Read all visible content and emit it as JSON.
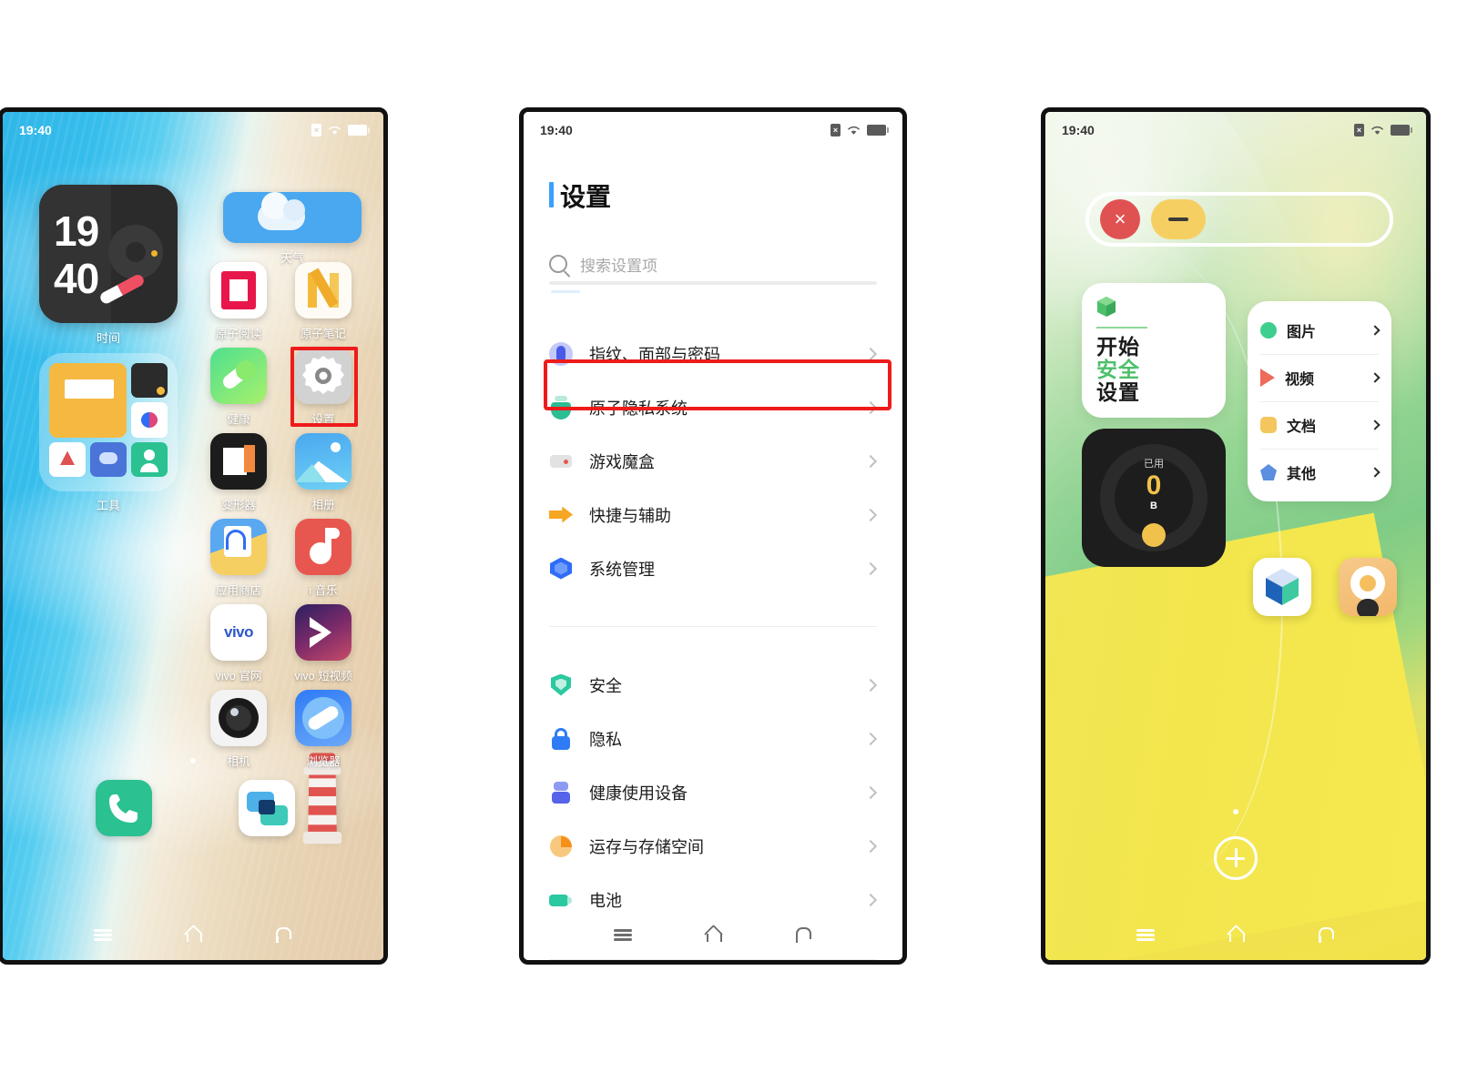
{
  "colors": {
    "highlight": "#ee1b1b",
    "accent_blue": "#3aa0ff",
    "accent_green": "#4cbf6a",
    "usage_yellow": "#f0c14b",
    "close_red": "#e05252",
    "minimize_yellow": "#f6cf62"
  },
  "panel1": {
    "name": "home-screen",
    "status": {
      "time": "19:40",
      "icons": [
        "sim-x-icon",
        "wifi-icon",
        "battery-icon"
      ]
    },
    "widgets": {
      "clock": {
        "hours": "19",
        "minutes": "40",
        "label": "时间"
      },
      "weather": {
        "label": "天气"
      },
      "folder": {
        "label": "工具"
      }
    },
    "apps": [
      {
        "label": "原子阅读",
        "icon": "atom-reader-icon"
      },
      {
        "label": "原子笔记",
        "icon": "atom-notes-icon"
      },
      {
        "label": "健康",
        "icon": "health-icon"
      },
      {
        "label": "设置",
        "icon": "settings-gear-icon"
      },
      {
        "label": "变形器",
        "icon": "transformer-icon"
      },
      {
        "label": "相册",
        "icon": "gallery-icon"
      },
      {
        "label": "应用商店",
        "icon": "app-store-icon"
      },
      {
        "label": "i 音乐",
        "icon": "i-music-icon"
      },
      {
        "label": "vivo 官网",
        "icon": "vivo-official-icon"
      },
      {
        "label": "vivo 短视频",
        "icon": "vivo-short-video-icon"
      },
      {
        "label": "相机",
        "icon": "camera-icon"
      },
      {
        "label": "浏览器",
        "icon": "browser-icon"
      }
    ],
    "dock": [
      {
        "label": "",
        "icon": "phone-icon"
      },
      {
        "label": "",
        "icon": "messages-icon"
      }
    ],
    "navbar": [
      "recent-apps-icon",
      "home-icon",
      "back-icon"
    ]
  },
  "panel2": {
    "name": "settings-screen",
    "status": {
      "time": "19:40"
    },
    "title": "设置",
    "search": {
      "placeholder": "搜索设置项",
      "value": "",
      "icon": "search-icon"
    },
    "group1": [
      {
        "label": "指纹、面部与密码",
        "icon": "fingerprint-icon",
        "color": "#6c7cf0"
      },
      {
        "label": "原子隐私系统",
        "icon": "atom-privacy-icon",
        "color": "#2bbd93",
        "highlighted": true
      },
      {
        "label": "游戏魔盒",
        "icon": "game-box-icon",
        "color": "#d8d8d8"
      },
      {
        "label": "快捷与辅助",
        "icon": "shortcut-assist-icon",
        "color": "#f5a623"
      },
      {
        "label": "系统管理",
        "icon": "system-manage-icon",
        "color": "#2f6df6"
      }
    ],
    "group2": [
      {
        "label": "安全",
        "icon": "shield-icon",
        "color": "#2bc9a0"
      },
      {
        "label": "隐私",
        "icon": "lock-icon",
        "color": "#2f7bf6"
      },
      {
        "label": "健康使用设备",
        "icon": "digital-wellbeing-icon",
        "color": "#5564e8"
      },
      {
        "label": "运存与存储空间",
        "icon": "storage-icon",
        "color": "#f5a623"
      },
      {
        "label": "电池",
        "icon": "battery-settings-icon",
        "color": "#2bc9a0"
      }
    ],
    "navbar": [
      "recent-apps-icon",
      "home-icon",
      "back-icon"
    ]
  },
  "panel3": {
    "name": "atom-privacy-system-screen",
    "status": {
      "time": "19:40"
    },
    "window_controls": {
      "close": "×",
      "minimize": "—"
    },
    "start_card": {
      "icon": "cube-icon",
      "line1": "开始",
      "line2": "安全",
      "line3": "设置"
    },
    "type_list": [
      {
        "label": "图片",
        "icon": "circle-icon",
        "color": "#3ecf8e"
      },
      {
        "label": "视频",
        "icon": "play-triangle-icon",
        "color": "#ec6b5a"
      },
      {
        "label": "文档",
        "icon": "rounded-square-icon",
        "color": "#f3c75e"
      },
      {
        "label": "其他",
        "icon": "pentagon-icon",
        "color": "#5b8fe0"
      }
    ],
    "usage_card": {
      "caption": "已用",
      "value": "0",
      "unit": "B"
    },
    "apps": [
      {
        "icon": "atom-cube-icon"
      },
      {
        "icon": "atom-camera-icon"
      }
    ],
    "add_button": "add-icon",
    "navbar": [
      "recent-apps-icon",
      "home-icon",
      "back-icon"
    ]
  }
}
